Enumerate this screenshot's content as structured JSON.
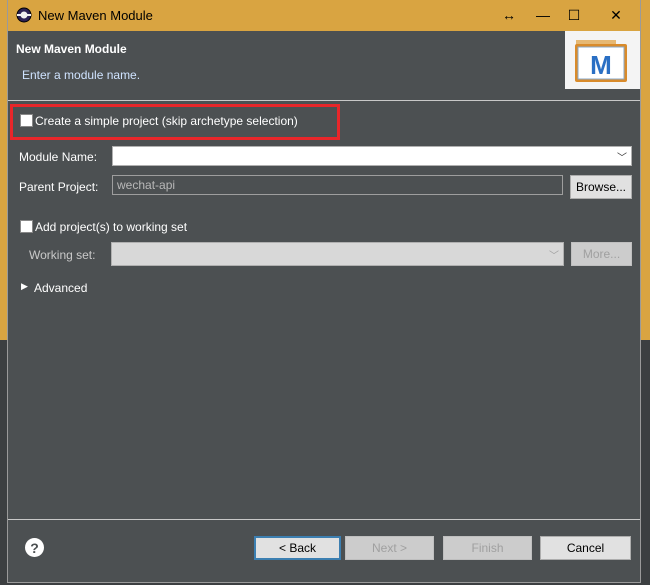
{
  "window": {
    "title": "New Maven Module",
    "controls": {
      "resize": "↔",
      "minimize": "—",
      "maximize": "☐",
      "close": "✕"
    }
  },
  "header": {
    "title": "New Maven Module",
    "description": "Enter a module name.",
    "logo_letter": "M"
  },
  "form": {
    "simple_project_label": "Create a simple project (skip archetype selection)",
    "simple_project_checked": false,
    "module_name_label": "Module Name:",
    "module_name_value": "",
    "parent_project_label": "Parent Project:",
    "parent_project_value": "wechat-api",
    "browse_label": "Browse...",
    "working_set_checkbox_label": "Add project(s) to working set",
    "working_set_checked": false,
    "working_set_label": "Working set:",
    "working_set_value": "",
    "more_label": "More...",
    "advanced_label": "Advanced"
  },
  "footer": {
    "help_glyph": "?",
    "back_label": "< Back",
    "next_label": "Next >",
    "finish_label": "Finish",
    "cancel_label": "Cancel"
  },
  "colors": {
    "titlebar": "#d9a441",
    "dialog_bg": "#4c5052",
    "highlight": "#e8262a"
  }
}
